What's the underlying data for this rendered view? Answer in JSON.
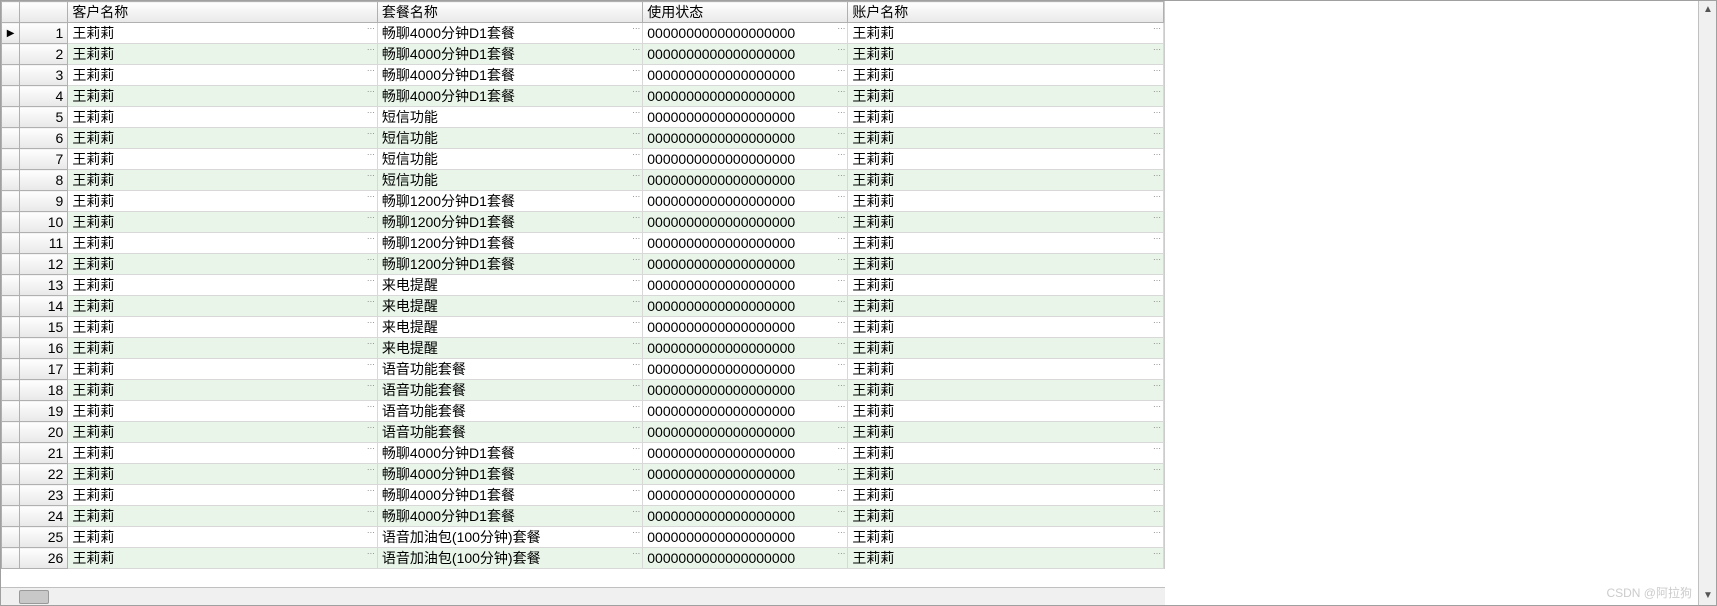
{
  "watermark": "CSDN @阿拉狗",
  "columns": [
    {
      "key": "customer_name",
      "label": "客户名称"
    },
    {
      "key": "package_name",
      "label": "套餐名称"
    },
    {
      "key": "usage_status",
      "label": "使用状态"
    },
    {
      "key": "account_name",
      "label": "账户名称"
    }
  ],
  "rows": [
    {
      "num": 1,
      "customer_name": "王莉莉",
      "package_name": "畅聊4000分钟D1套餐",
      "usage_status": "0000000000000000000",
      "account_name": "王莉莉"
    },
    {
      "num": 2,
      "customer_name": "王莉莉",
      "package_name": "畅聊4000分钟D1套餐",
      "usage_status": "0000000000000000000",
      "account_name": "王莉莉"
    },
    {
      "num": 3,
      "customer_name": "王莉莉",
      "package_name": "畅聊4000分钟D1套餐",
      "usage_status": "0000000000000000000",
      "account_name": "王莉莉"
    },
    {
      "num": 4,
      "customer_name": "王莉莉",
      "package_name": "畅聊4000分钟D1套餐",
      "usage_status": "0000000000000000000",
      "account_name": "王莉莉"
    },
    {
      "num": 5,
      "customer_name": "王莉莉",
      "package_name": "短信功能",
      "usage_status": "0000000000000000000",
      "account_name": "王莉莉"
    },
    {
      "num": 6,
      "customer_name": "王莉莉",
      "package_name": "短信功能",
      "usage_status": "0000000000000000000",
      "account_name": "王莉莉"
    },
    {
      "num": 7,
      "customer_name": "王莉莉",
      "package_name": "短信功能",
      "usage_status": "0000000000000000000",
      "account_name": "王莉莉"
    },
    {
      "num": 8,
      "customer_name": "王莉莉",
      "package_name": "短信功能",
      "usage_status": "0000000000000000000",
      "account_name": "王莉莉"
    },
    {
      "num": 9,
      "customer_name": "王莉莉",
      "package_name": "畅聊1200分钟D1套餐",
      "usage_status": "0000000000000000000",
      "account_name": "王莉莉"
    },
    {
      "num": 10,
      "customer_name": "王莉莉",
      "package_name": "畅聊1200分钟D1套餐",
      "usage_status": "0000000000000000000",
      "account_name": "王莉莉"
    },
    {
      "num": 11,
      "customer_name": "王莉莉",
      "package_name": "畅聊1200分钟D1套餐",
      "usage_status": "0000000000000000000",
      "account_name": "王莉莉"
    },
    {
      "num": 12,
      "customer_name": "王莉莉",
      "package_name": "畅聊1200分钟D1套餐",
      "usage_status": "0000000000000000000",
      "account_name": "王莉莉"
    },
    {
      "num": 13,
      "customer_name": "王莉莉",
      "package_name": "来电提醒",
      "usage_status": "0000000000000000000",
      "account_name": "王莉莉"
    },
    {
      "num": 14,
      "customer_name": "王莉莉",
      "package_name": "来电提醒",
      "usage_status": "0000000000000000000",
      "account_name": "王莉莉"
    },
    {
      "num": 15,
      "customer_name": "王莉莉",
      "package_name": "来电提醒",
      "usage_status": "0000000000000000000",
      "account_name": "王莉莉"
    },
    {
      "num": 16,
      "customer_name": "王莉莉",
      "package_name": "来电提醒",
      "usage_status": "0000000000000000000",
      "account_name": "王莉莉"
    },
    {
      "num": 17,
      "customer_name": "王莉莉",
      "package_name": "语音功能套餐",
      "usage_status": "0000000000000000000",
      "account_name": "王莉莉"
    },
    {
      "num": 18,
      "customer_name": "王莉莉",
      "package_name": "语音功能套餐",
      "usage_status": "0000000000000000000",
      "account_name": "王莉莉"
    },
    {
      "num": 19,
      "customer_name": "王莉莉",
      "package_name": "语音功能套餐",
      "usage_status": "0000000000000000000",
      "account_name": "王莉莉"
    },
    {
      "num": 20,
      "customer_name": "王莉莉",
      "package_name": "语音功能套餐",
      "usage_status": "0000000000000000000",
      "account_name": "王莉莉"
    },
    {
      "num": 21,
      "customer_name": "王莉莉",
      "package_name": "畅聊4000分钟D1套餐",
      "usage_status": "0000000000000000000",
      "account_name": "王莉莉"
    },
    {
      "num": 22,
      "customer_name": "王莉莉",
      "package_name": "畅聊4000分钟D1套餐",
      "usage_status": "0000000000000000000",
      "account_name": "王莉莉"
    },
    {
      "num": 23,
      "customer_name": "王莉莉",
      "package_name": "畅聊4000分钟D1套餐",
      "usage_status": "0000000000000000000",
      "account_name": "王莉莉"
    },
    {
      "num": 24,
      "customer_name": "王莉莉",
      "package_name": "畅聊4000分钟D1套餐",
      "usage_status": "0000000000000000000",
      "account_name": "王莉莉"
    },
    {
      "num": 25,
      "customer_name": "王莉莉",
      "package_name": "语音加油包(100分钟)套餐",
      "usage_status": "0000000000000000000",
      "account_name": "王莉莉"
    },
    {
      "num": 26,
      "customer_name": "王莉莉",
      "package_name": "语音加油包(100分钟)套餐",
      "usage_status": "0000000000000000000",
      "account_name": "王莉莉"
    }
  ],
  "selected_row": 1
}
